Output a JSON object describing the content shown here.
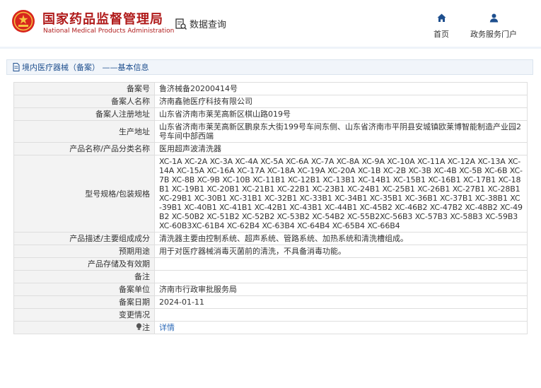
{
  "header": {
    "brand_cn": "国家药品监督管理局",
    "brand_en": "National Medical Products Administration",
    "query_label": "数据查询",
    "nav": [
      {
        "label": "首页",
        "icon": "home-icon"
      },
      {
        "label": "政务服务门户",
        "icon": "user-icon"
      }
    ]
  },
  "section": {
    "title": "境内医疗器械（备案） ——基本信息"
  },
  "record": {
    "rows": [
      {
        "label": "备案号",
        "value": "鲁济械备20200414号"
      },
      {
        "label": "备案人名称",
        "value": "济南鑫驰医疗科技有限公司"
      },
      {
        "label": "备案人注册地址",
        "value": "山东省济南市莱芜高新区棋山路019号"
      },
      {
        "label": "生产地址",
        "value": "山东省济南市莱芜高新区鹏泉东大街199号车间东侧、山东省济南市平阴县安城镇欧莱博智能制造产业园2号车间中部西端"
      },
      {
        "label": "产品名称/产品分类名称",
        "value": "医用超声波清洗器"
      },
      {
        "label": "型号规格/包装规格",
        "value": "XC-1A XC-2A XC-3A XC-4A XC-5A XC-6A XC-7A XC-8A XC-9A XC-10A XC-11A XC-12A XC-13A XC-14A XC-15A XC-16A XC-17A XC-18A XC-19A XC-20A XC-1B XC-2B XC-3B XC-4B XC-5B XC-6B XC-7B XC-8B XC-9B XC-10B XC-11B1 XC-12B1 XC-13B1 XC-14B1 XC-15B1 XC-16B1 XC-17B1 XC-18B1 XC-19B1 XC-20B1 XC-21B1 XC-22B1 XC-23B1 XC-24B1 XC-25B1 XC-26B1 XC-27B1 XC-28B1 XC-29B1 XC-30B1 XC-31B1 XC-32B1 XC-33B1 XC-34B1 XC-35B1 XC-36B1 XC-37B1 XC-38B1 XC-39B1 XC-40B1 XC-41B1 XC-42B1 XC-43B1 XC-44B1 XC-45B2 XC-46B2 XC-47B2 XC-48B2 XC-49B2 XC-50B2 XC-51B2 XC-52B2 XC-53B2 XC-54B2 XC-55B2XC-56B3 XC-57B3 XC-58B3 XC-59B3 XC-60B3XC-61B4 XC-62B4 XC-63B4 XC-64B4 XC-65B4 XC-66B4"
      },
      {
        "label": "产品描述/主要组成成分",
        "value": "清洗器主要由控制系统、超声系统、管路系统、加热系统和清洗槽组成。"
      },
      {
        "label": "预期用途",
        "value": "用于对医疗器械消毒灭菌前的清洗，不具备消毒功能。"
      },
      {
        "label": "产品存储及有效期",
        "value": ""
      },
      {
        "label": "备注",
        "value": ""
      },
      {
        "label": "备案单位",
        "value": "济南市行政审批服务局"
      },
      {
        "label": "备案日期",
        "value": "2024-01-11"
      },
      {
        "label": "变更情况",
        "value": ""
      },
      {
        "label": "注",
        "value": "详情",
        "icon": "bulb-icon"
      }
    ]
  },
  "colors": {
    "brand": "#b01b1b",
    "link": "#2c69b7",
    "section_text": "#1e4f8e"
  }
}
